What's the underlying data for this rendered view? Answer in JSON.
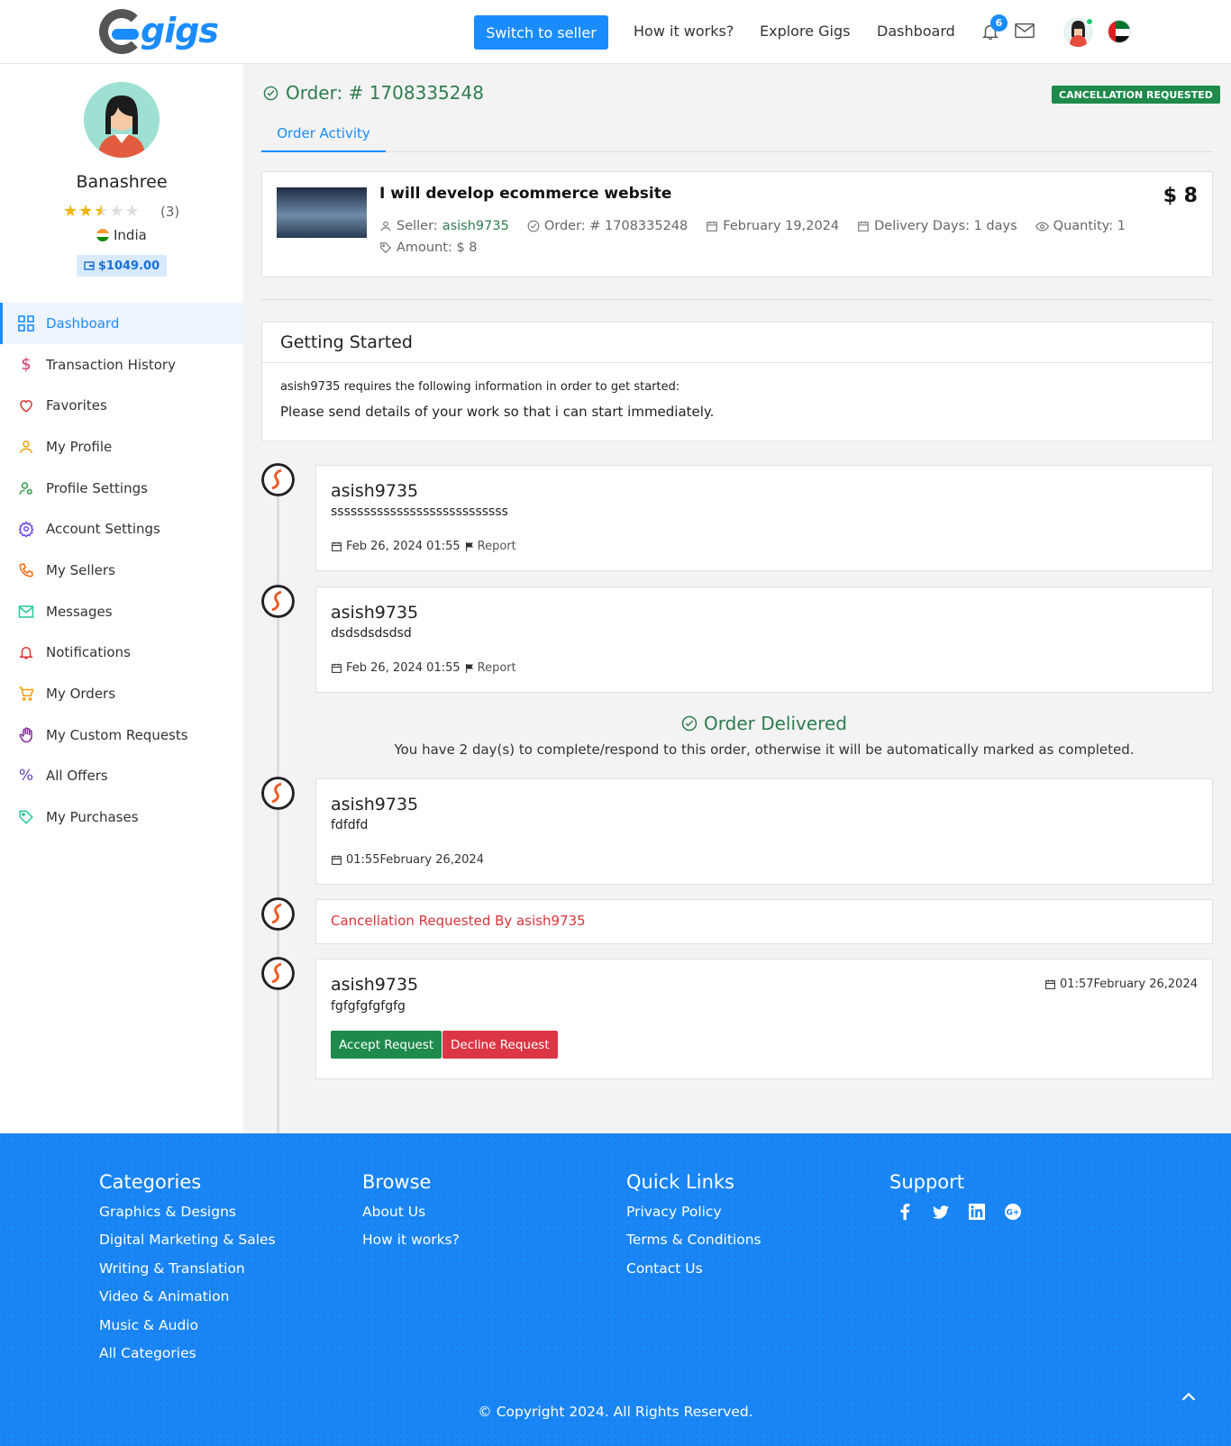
{
  "header": {
    "logo_text": "gigs",
    "switch_label": "Switch to seller",
    "nav": [
      "How it works?",
      "Explore Gigs",
      "Dashboard"
    ],
    "notification_count": "6"
  },
  "sidebar": {
    "name": "Banashree",
    "rating": 2.5,
    "rating_count": "(3)",
    "country": "India",
    "balance": "$1049.00",
    "menu": [
      {
        "label": "Dashboard",
        "icon": "grid-icon",
        "active": true
      },
      {
        "label": "Transaction History",
        "icon": "dollar-icon"
      },
      {
        "label": "Favorites",
        "icon": "heart-icon"
      },
      {
        "label": "My Profile",
        "icon": "user-icon"
      },
      {
        "label": "Profile Settings",
        "icon": "user-gear-icon"
      },
      {
        "label": "Account Settings",
        "icon": "gear-icon"
      },
      {
        "label": "My Sellers",
        "icon": "phone-icon"
      },
      {
        "label": "Messages",
        "icon": "mail-icon"
      },
      {
        "label": "Notifications",
        "icon": "bell-icon"
      },
      {
        "label": "My Orders",
        "icon": "cart-icon"
      },
      {
        "label": "My Custom Requests",
        "icon": "hand-icon"
      },
      {
        "label": "All Offers",
        "icon": "percent-icon"
      },
      {
        "label": "My Purchases",
        "icon": "tag-icon"
      }
    ]
  },
  "order": {
    "title": "Order: # 1708335248",
    "status": "CANCELLATION REQUESTED",
    "tab": "Order Activity",
    "gig_title": "I will develop ecommerce website",
    "price": "$ 8",
    "seller_label": "Seller:",
    "seller": "asish9735",
    "order_no": "Order: # 1708335248",
    "date": "February 19,2024",
    "delivery": "Delivery Days: 1 days",
    "quantity": "Quantity: 1",
    "amount": "Amount: $ 8"
  },
  "getting_started": {
    "title": "Getting Started",
    "subtitle": "asish9735 requires the following information in order to get started:",
    "text": "Please send details of your work so that i can start immediately."
  },
  "activity": {
    "msg1": {
      "user": "asish9735",
      "text": "sssssssssssssssssssssssssss",
      "date": "Feb 26, 2024 01:55",
      "report": "Report"
    },
    "msg2": {
      "user": "asish9735",
      "text": "dsdsdsdsdsd",
      "date": "Feb 26, 2024 01:55",
      "report": "Report"
    },
    "delivered_title": "Order Delivered",
    "delivered_sub": "You have 2 day(s) to complete/respond to this order, otherwise it will be automatically marked as completed.",
    "msg3": {
      "user": "asish9735",
      "text": "fdfdfd",
      "date": "01:55February 26,2024"
    },
    "cancel_text": "Cancellation Requested By asish9735",
    "msg4": {
      "user": "asish9735",
      "text": "fgfgfgfgfgfg",
      "date": "01:57February 26,2024"
    },
    "accept_label": "Accept Request",
    "decline_label": "Decline Request"
  },
  "footer": {
    "categories": {
      "title": "Categories",
      "links": [
        "Graphics & Designs",
        "Digital Marketing & Sales",
        "Writing & Translation",
        "Video & Animation",
        "Music & Audio",
        "All Categories"
      ]
    },
    "browse": {
      "title": "Browse",
      "links": [
        "About Us",
        "How it works?"
      ]
    },
    "quick": {
      "title": "Quick Links",
      "links": [
        "Privacy Policy",
        "Terms & Conditions",
        "Contact Us"
      ]
    },
    "support": {
      "title": "Support"
    },
    "copyright": "© Copyright 2024. All Rights Reserved."
  },
  "colors": {
    "primary": "#1a8cff",
    "success": "#1e8a4c",
    "danger": "#dc3545",
    "footer": "#1a86f6"
  }
}
